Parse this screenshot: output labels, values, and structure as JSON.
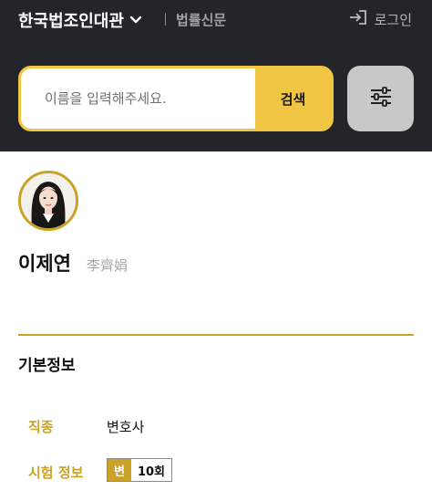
{
  "header": {
    "brand_label": "한국법조인대관",
    "news_label": "법률신문",
    "login_label": "로그인"
  },
  "search": {
    "placeholder": "이름을 입력해주세요.",
    "button_label": "검색"
  },
  "profile": {
    "name": "이제연",
    "hanja": "李齊娟"
  },
  "basic_info": {
    "section_title": "기본정보",
    "job_label": "직종",
    "job_value": "변호사",
    "exam_label": "시험 정보",
    "exam_type": "변",
    "exam_round": "10회"
  },
  "colors": {
    "header_bg": "#24252b",
    "accent": "#f0c544",
    "gold": "#c9a227"
  },
  "icons": [
    "chevron-down-icon",
    "login-icon",
    "filter-sliders-icon",
    "avatar-photo"
  ]
}
